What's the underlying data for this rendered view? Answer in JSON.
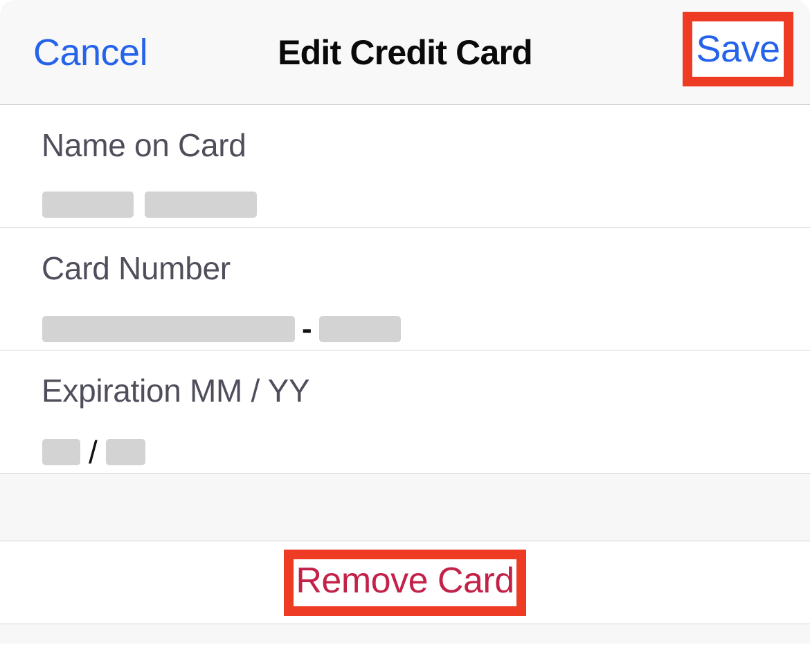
{
  "navbar": {
    "cancel_label": "Cancel",
    "title": "Edit Credit Card",
    "save_label": "Save"
  },
  "form": {
    "rows": [
      {
        "label": "Name on Card",
        "value_redacted": true,
        "separator": ""
      },
      {
        "label": "Card Number",
        "value_redacted": true,
        "separator": "-"
      },
      {
        "label": "Expiration MM / YY",
        "value_redacted": true,
        "separator": "/"
      }
    ]
  },
  "actions": {
    "remove_label": "Remove Card"
  },
  "colors": {
    "link_blue": "#2563eb",
    "destructive_red": "#c32148",
    "highlight_red": "#ee3b24",
    "label_gray": "#4f4f5c",
    "redaction_gray": "#d3d3d3",
    "header_bg": "#f8f8f8",
    "spacer_bg": "#f7f7f7",
    "divider": "#d4d4d6"
  }
}
